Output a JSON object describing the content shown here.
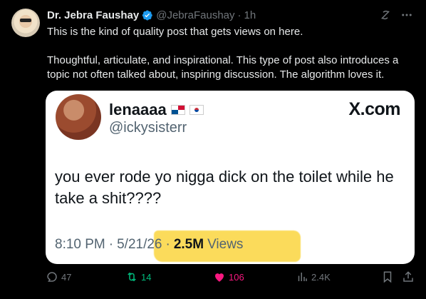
{
  "author": {
    "display_name": "Dr. Jebra Faushay",
    "handle": "@JebraFaushay",
    "separator": "·",
    "time": "1h"
  },
  "body": {
    "paragraph1": "This is the kind of quality post that gets views on here.",
    "paragraph2": "Thoughtful, articulate, and inspirational. This type of post also introduces a topic not often talked about, inspiring discussion. The algorithm loves it."
  },
  "quoted_card": {
    "name": "lenaaaa",
    "handle": "@ickysisterr",
    "logo": "X.com",
    "text": "you ever rode yo nigga dick on the toilet while he take a shit????",
    "time": "8:10 PM",
    "date": "5/21/26",
    "separator": "·",
    "views_count": "2.5M",
    "views_label": "Views",
    "highlight_color": "#fbd84a"
  },
  "actions": {
    "replies": "47",
    "reposts": "14",
    "likes": "106",
    "views": "2.4K"
  },
  "icons": {
    "verified": "verified-badge-icon",
    "grok": "grok-icon",
    "more": "more-icon",
    "reply": "reply-icon",
    "repost": "repost-icon",
    "like": "heart-icon",
    "views": "analytics-icon",
    "bookmark": "bookmark-icon",
    "share": "share-icon"
  },
  "colors": {
    "background": "#000000",
    "text": "#e7e9ea",
    "muted": "#71767b",
    "verified": "#1d9bf0",
    "repost": "#00ba7c",
    "like": "#f91880"
  }
}
